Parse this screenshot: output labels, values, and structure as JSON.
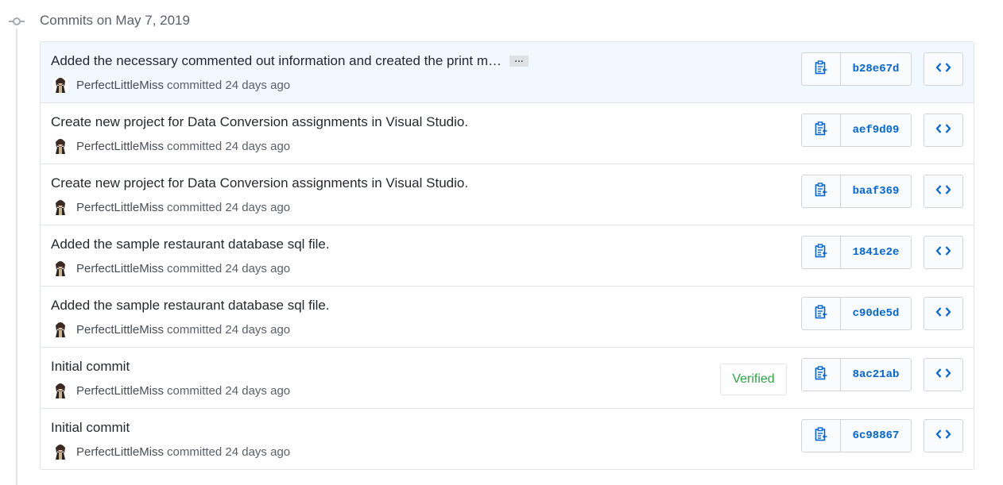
{
  "group": {
    "title": "Commits on May 7, 2019"
  },
  "colors": {
    "link": "#0366d6",
    "verified": "#28a745",
    "highlight_row": "#f1f8ff",
    "border": "#e1e4e8"
  },
  "commits": [
    {
      "title": "Added the necessary commented out information and created the print m…",
      "has_ellipsis": true,
      "ellipsis_label": "…",
      "author": "PerfectLittleMiss",
      "action": "committed 24 days ago",
      "sha": "b28e67d",
      "verified": false
    },
    {
      "title": "Create new project for Data Conversion assignments in Visual Studio.",
      "has_ellipsis": false,
      "author": "PerfectLittleMiss",
      "action": "committed 24 days ago",
      "sha": "aef9d09",
      "verified": false
    },
    {
      "title": "Create new project for Data Conversion assignments in Visual Studio.",
      "has_ellipsis": false,
      "author": "PerfectLittleMiss",
      "action": "committed 24 days ago",
      "sha": "baaf369",
      "verified": false
    },
    {
      "title": "Added the sample restaurant database sql file.",
      "has_ellipsis": false,
      "author": "PerfectLittleMiss",
      "action": "committed 24 days ago",
      "sha": "1841e2e",
      "verified": false
    },
    {
      "title": "Added the sample restaurant database sql file.",
      "has_ellipsis": false,
      "author": "PerfectLittleMiss",
      "action": "committed 24 days ago",
      "sha": "c90de5d",
      "verified": false
    },
    {
      "title": "Initial commit",
      "has_ellipsis": false,
      "author": "PerfectLittleMiss",
      "action": "committed 24 days ago",
      "sha": "8ac21ab",
      "verified": true,
      "verified_label": "Verified"
    },
    {
      "title": "Initial commit",
      "has_ellipsis": false,
      "author": "PerfectLittleMiss",
      "action": "committed 24 days ago",
      "sha": "6c98867",
      "verified": false
    }
  ],
  "icons": {
    "group": "git-commit-icon",
    "copy": "clipboard-icon",
    "browse": "code-icon",
    "avatar": "user-avatar"
  }
}
